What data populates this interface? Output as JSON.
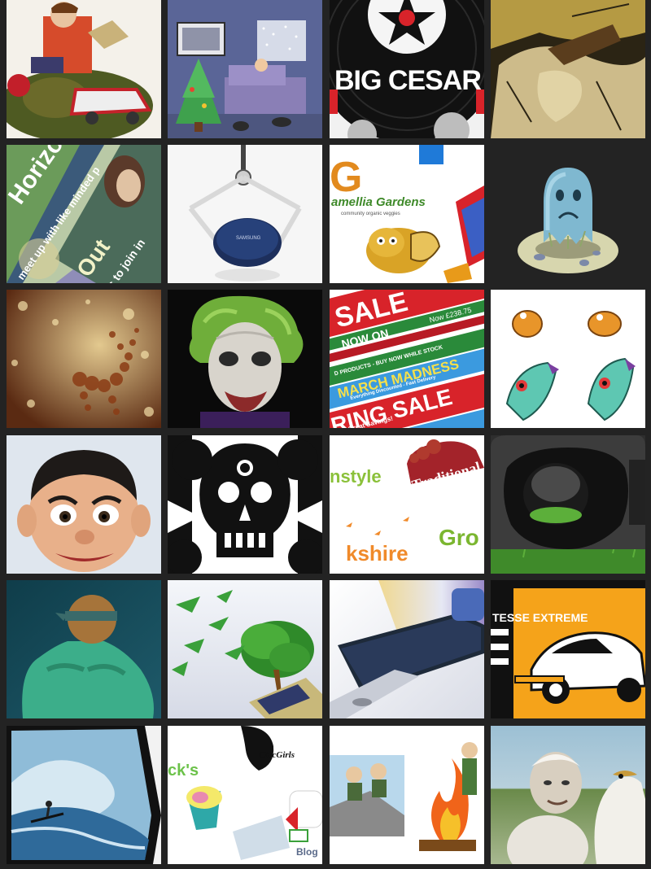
{
  "gallery": {
    "rows": [
      [
        {
          "label": "boy-toy-car-illustration"
        },
        {
          "label": "christmas-living-room-illustration"
        },
        {
          "label": "big-cesar-record-logo",
          "text": "BIG CESAR"
        },
        {
          "label": "woodcut-illustration"
        }
      ],
      [
        {
          "label": "horizons-banner",
          "text_a": "Horizons",
          "text_b": "meet up with like minded p",
          "text_c": "Out",
          "text_d": "s to join in"
        },
        {
          "label": "wireless-charger-product",
          "text": "SAMSUNG"
        },
        {
          "label": "camellia-gardens-collage",
          "text_a": "G",
          "text_b": "amellia Gardens",
          "text_c": "community organic veggies"
        },
        {
          "label": "sad-ghost-character"
        }
      ],
      [
        {
          "label": "bokeh-deer-artwork"
        },
        {
          "label": "joker-einstein-portrait"
        },
        {
          "label": "spring-sale-banners",
          "text_a": "SALE",
          "text_b": "NOW ON",
          "text_c": "Now £238.75",
          "text_d": "MARCH MADNESS",
          "text_e": "Everything Discounted - Fast Delivery",
          "text_f": "RING SALE",
          "text_g": "ing Great Savings!",
          "text_h": "D PRODUCTS - BUY NOW WHILE STOCK"
        },
        {
          "label": "frog-fish-sprites"
        }
      ],
      [
        {
          "label": "mr-bean-caricature"
        },
        {
          "label": "skull-collage-artwork"
        },
        {
          "label": "yorkshire-logo-collage",
          "text_a": "nstyle",
          "text_b": "Traditional",
          "text_c": "kshire",
          "text_d": "Gro"
        },
        {
          "label": "vr-headset-product"
        }
      ],
      [
        {
          "label": "muscular-figure-3d"
        },
        {
          "label": "paper-birds-tree"
        },
        {
          "label": "galaxy-phone-product"
        },
        {
          "label": "sports-car-poster",
          "text": "TESSE EXTREME"
        }
      ],
      [
        {
          "label": "surfer-wave-artwork"
        },
        {
          "label": "chic-girls-logo-collage",
          "text_a": "ck's",
          "text_b": "ChicGirls",
          "text_c": "Blog"
        },
        {
          "label": "cartoon-fire-scene"
        },
        {
          "label": "seagull-old-man-painting"
        }
      ]
    ]
  }
}
